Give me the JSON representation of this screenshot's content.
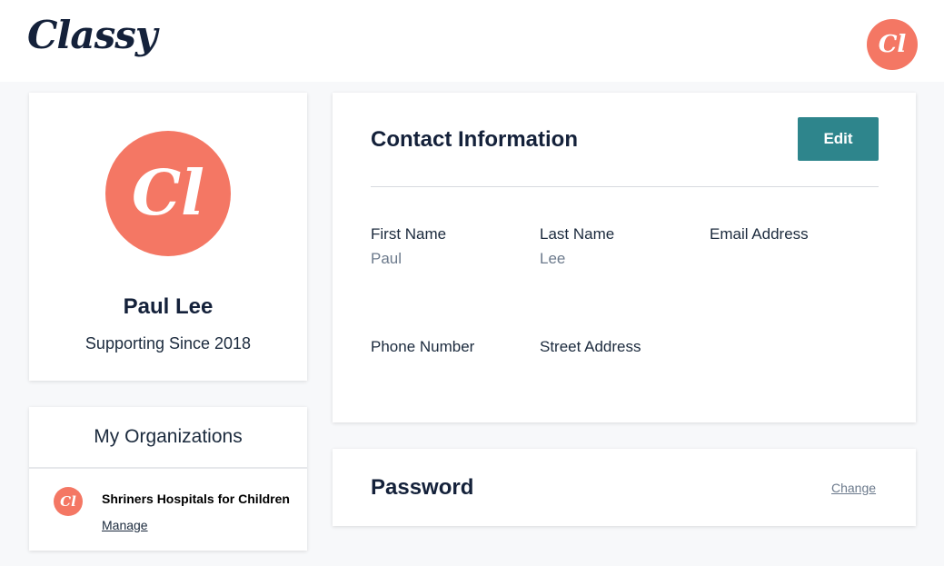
{
  "header": {
    "logo_text": "Classy",
    "avatar_initials": "Cl"
  },
  "profile": {
    "avatar_initials": "Cl",
    "name": "Paul Lee",
    "supporting_since": "Supporting Since 2018"
  },
  "organizations": {
    "title": "My Organizations",
    "items": [
      {
        "avatar_initials": "Cl",
        "name": "Shriners Hospitals for Children",
        "manage_label": "Manage"
      }
    ]
  },
  "contact": {
    "title": "Contact Information",
    "edit_label": "Edit",
    "fields": {
      "first_name": {
        "label": "First Name",
        "value": "Paul"
      },
      "last_name": {
        "label": "Last Name",
        "value": "Lee"
      },
      "email": {
        "label": "Email Address",
        "value": ""
      },
      "phone": {
        "label": "Phone Number",
        "value": ""
      },
      "street": {
        "label": "Street Address",
        "value": ""
      }
    }
  },
  "password": {
    "title": "Password",
    "change_label": "Change"
  },
  "colors": {
    "accent_avatar": "#f47764",
    "button_primary": "#2e858c",
    "page_background": "#f7f8fa",
    "heading_text": "#14213a",
    "muted_text": "#6c7a8c"
  }
}
